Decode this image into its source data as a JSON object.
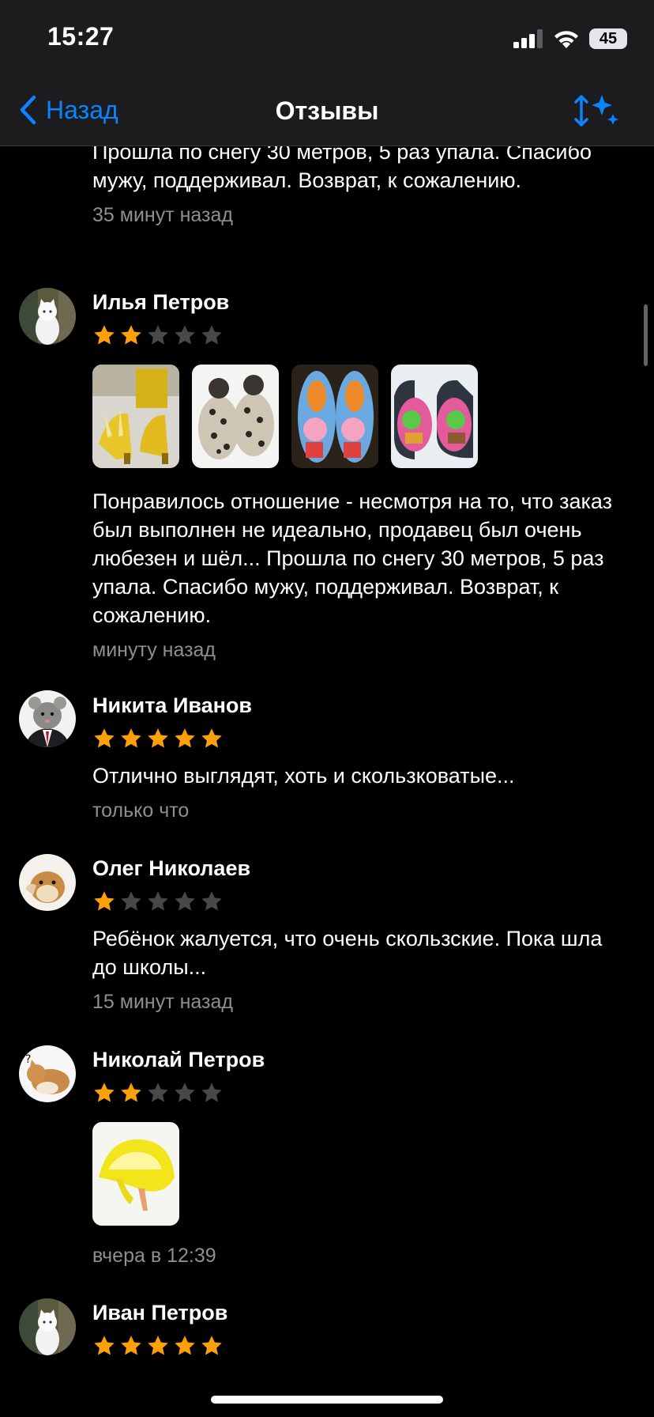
{
  "status": {
    "time": "15:27",
    "battery": "45"
  },
  "nav": {
    "back_label": "Назад",
    "title": "Отзывы"
  },
  "colors": {
    "accent": "#0a84ff",
    "star": "#ff9f0a",
    "star_empty": "#48484a",
    "muted": "#8e8e93"
  },
  "reviews": [
    {
      "author": "",
      "rating": null,
      "text": "Прошла по снегу 30 метров, 5 раз упала. Спасибо мужу, поддерживал. Возврат, к сожалению.",
      "time": "35 минут назад"
    },
    {
      "author": "Илья Петров",
      "rating": 2,
      "photos": [
        "banana-heels-photo",
        "leopard-slippers-photo",
        "peppa-shoes-photo",
        "frog-shoes-photo"
      ],
      "text": "Понравилось отношение - несмотря на то, что заказ был выполнен не идеально, продавец был очень любезен и шёл... Прошла по снегу 30 метров, 5 раз упала. Спасибо мужу, поддерживал. Возврат, к сожалению.",
      "time": "минуту назад"
    },
    {
      "author": "Никита Иванов",
      "rating": 5,
      "text": "Отлично выглядят, хоть и скользковатые...",
      "time": "только что"
    },
    {
      "author": "Олег Николаев",
      "rating": 1,
      "text": "Ребёнок жалуется, что очень скользские. Пока шла до школы...",
      "time": "15 минут назад"
    },
    {
      "author": "Николай Петров",
      "rating": 2,
      "photos": [
        "fluffy-yellow-heels-photo"
      ],
      "text": "",
      "time": "вчера в 12:39"
    },
    {
      "author": "Иван Петров",
      "rating": 5,
      "text": "",
      "time": ""
    }
  ]
}
